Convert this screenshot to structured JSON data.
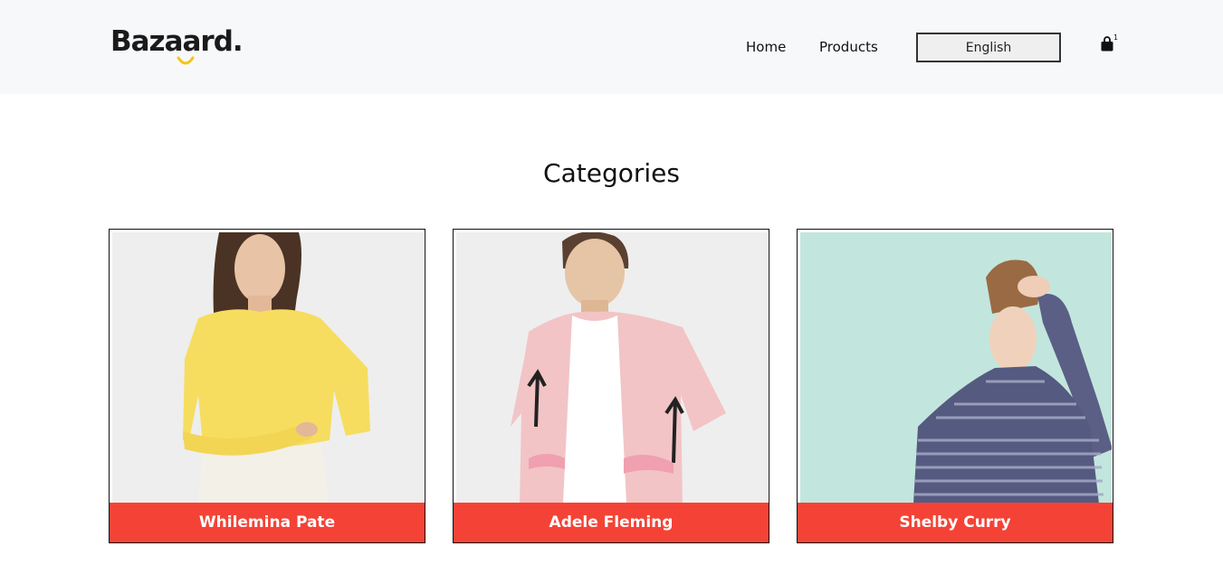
{
  "header": {
    "logo_text": "Bazaard.",
    "nav": [
      {
        "label": "Home"
      },
      {
        "label": "Products"
      }
    ],
    "language": {
      "selected": "English"
    },
    "cart": {
      "icon": "shopping-bag-icon",
      "count": "1"
    }
  },
  "main": {
    "title": "Categories",
    "categories": [
      {
        "name": "Whilemina Pate",
        "image": "woman-yellow-blouse"
      },
      {
        "name": "Adele Fleming",
        "image": "man-pink-palm-shirt"
      },
      {
        "name": "Shelby Curry",
        "image": "man-striped-turtleneck"
      }
    ]
  },
  "colors": {
    "header_bg": "#f7f8fa",
    "accent": "#f44336",
    "logo_smile": "#f5c518",
    "card3_bg": "#c2e6dd"
  }
}
